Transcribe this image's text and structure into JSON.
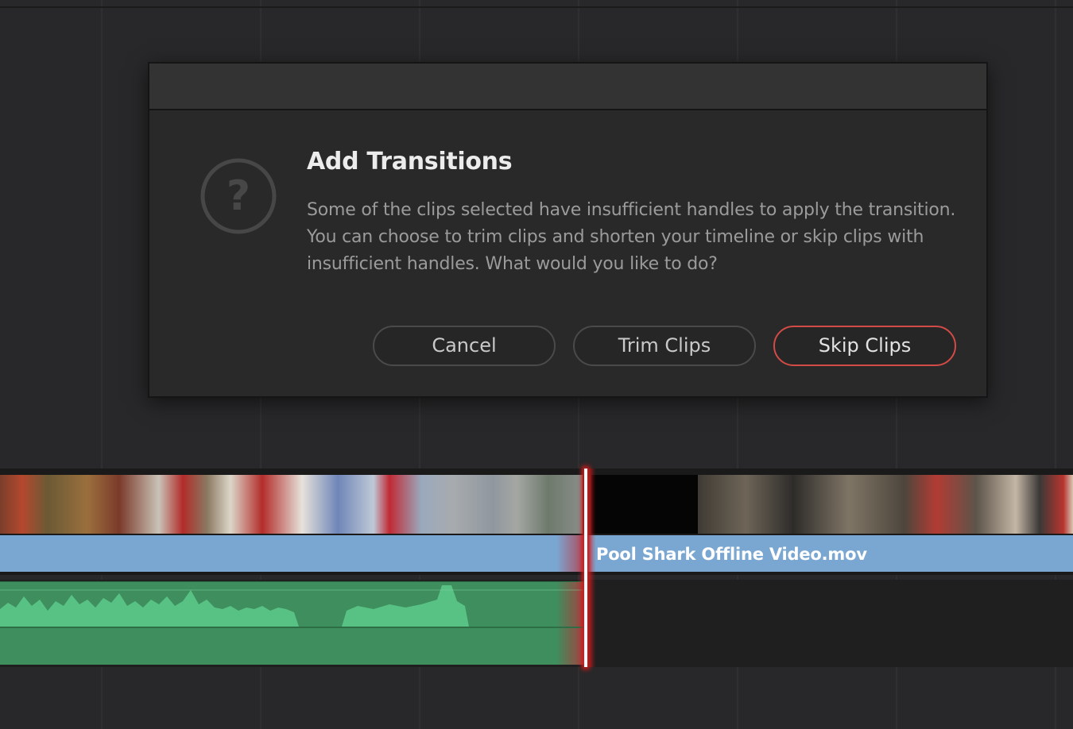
{
  "dialog": {
    "title": "Add Transitions",
    "message": "Some of the clips selected have insufficient handles to apply the transition. You can choose to trim clips and shorten your timeline or skip clips with insufficient handles. What would you like to do?",
    "icon": "question-mark-icon",
    "buttons": {
      "cancel": "Cancel",
      "trim": "Trim Clips",
      "skip": "Skip Clips"
    }
  },
  "timeline": {
    "video_clip_name": "Pool Shark Offline Video.mov"
  },
  "colors": {
    "background": "#28282a",
    "accent_red": "#d24b46",
    "video_clip": "#7aa7d2",
    "audio_clip": "#3f8e5e",
    "waveform": "#58c184"
  }
}
